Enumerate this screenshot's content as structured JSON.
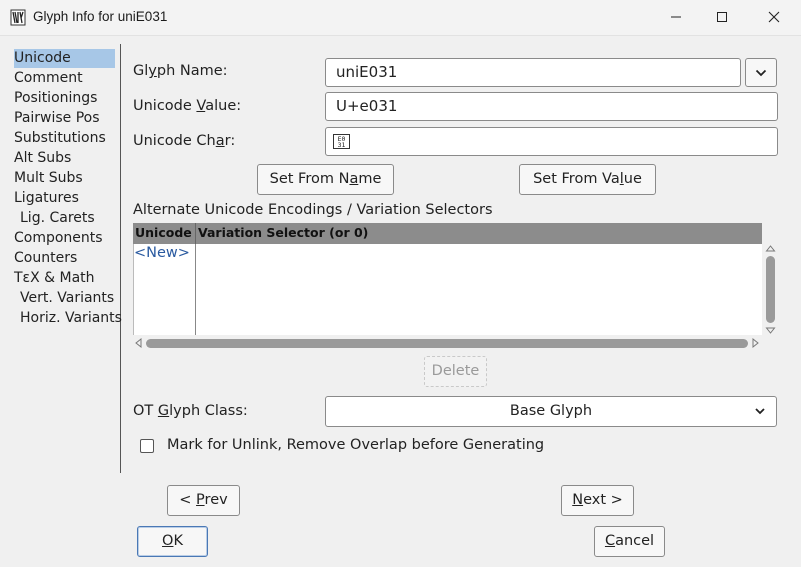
{
  "window": {
    "title": "Glyph Info for uniE031"
  },
  "sidebar": {
    "items": [
      {
        "label": "Unicode",
        "selected": true
      },
      {
        "label": "Comment"
      },
      {
        "label": "Positionings"
      },
      {
        "label": "Pairwise Pos"
      },
      {
        "label": "Substitutions"
      },
      {
        "label": "Alt Subs"
      },
      {
        "label": "Mult Subs"
      },
      {
        "label": "Ligatures"
      },
      {
        "label": "Lig. Carets"
      },
      {
        "label": "Components"
      },
      {
        "label": "Counters"
      },
      {
        "label": "TεX & Math"
      },
      {
        "label": "Vert. Variants"
      },
      {
        "label": "Horiz. Variants"
      }
    ]
  },
  "form": {
    "glyph_name": {
      "label_a": "Gl",
      "label_u": "y",
      "label_b": "ph Name:",
      "value": "uniE031"
    },
    "unicode_value": {
      "label_a": "Unicode ",
      "label_u": "V",
      "label_b": "alue:",
      "value": "U+e031"
    },
    "unicode_char": {
      "label_a": "Unicode Ch",
      "label_u": "a",
      "label_b": "r:",
      "value": "E031"
    },
    "set_from_name": {
      "a": "Set From N",
      "u": "a",
      "b": "me"
    },
    "set_from_value": {
      "a": "Set From Va",
      "u": "l",
      "b": "ue"
    }
  },
  "alternates": {
    "section_label": "Alternate Unicode Encodings / Variation Selectors",
    "columns": [
      "Unicode",
      "Variation Selector (or 0)"
    ],
    "new_row_label": "<New>",
    "delete_label": "Delete"
  },
  "ot_class": {
    "label_a": "OT ",
    "label_u": "G",
    "label_b": "lyph Class:",
    "selected": "Base Glyph"
  },
  "unlink": {
    "label": "Mark for Unlink, Remove Overlap before Generating",
    "checked": false
  },
  "nav": {
    "prev": {
      "a": "< ",
      "u": "P",
      "b": "rev"
    },
    "next": {
      "a": "",
      "u": "N",
      "b": "ext >"
    },
    "ok": {
      "a": "",
      "u": "O",
      "b": "K"
    },
    "cancel": {
      "a": "",
      "u": "C",
      "b": "ancel"
    }
  }
}
